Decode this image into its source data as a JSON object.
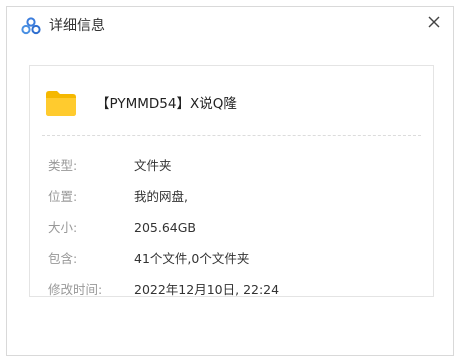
{
  "dialog": {
    "title": "详细信息",
    "app_icon": "cloud-drive-logo-icon",
    "close_icon": "close-icon"
  },
  "file": {
    "icon": "folder-icon",
    "icon_color": "#F7C531",
    "name": "【PYMMD54】X说Q隆"
  },
  "details": [
    {
      "label": "类型:",
      "value": "文件夹"
    },
    {
      "label": "位置:",
      "value": "我的网盘,"
    },
    {
      "label": "大小:",
      "value": "205.64GB"
    },
    {
      "label": "包含:",
      "value": "41个文件,0个文件夹"
    },
    {
      "label": "修改时间:",
      "value": "2022年12月10日, 22:24"
    }
  ],
  "colors": {
    "label": "#999999",
    "value": "#333333",
    "logo_blue": "#3B7DDD"
  }
}
